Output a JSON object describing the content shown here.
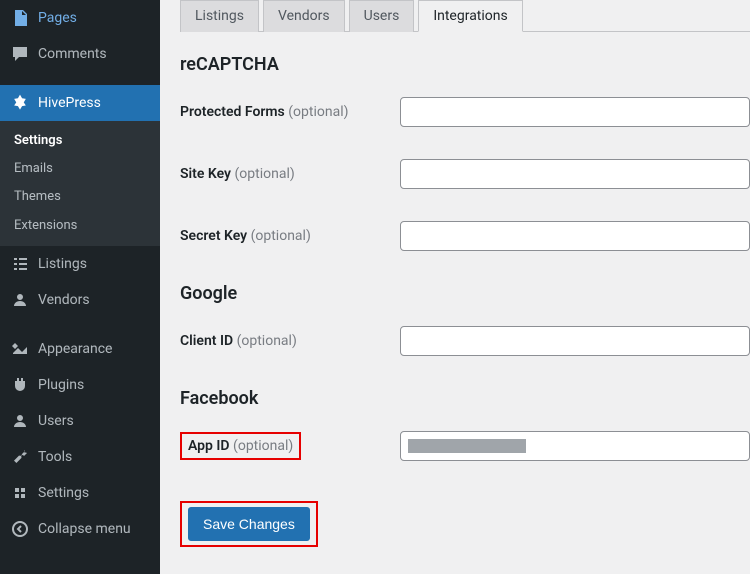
{
  "sidebar": {
    "pages": "Pages",
    "comments": "Comments",
    "hivepress": "HivePress",
    "submenu": {
      "settings": "Settings",
      "emails": "Emails",
      "themes": "Themes",
      "extensions": "Extensions"
    },
    "listings": "Listings",
    "vendors": "Vendors",
    "appearance": "Appearance",
    "plugins": "Plugins",
    "users": "Users",
    "tools": "Tools",
    "settings_main": "Settings",
    "collapse": "Collapse menu"
  },
  "tabs": {
    "listings": "Listings",
    "vendors": "Vendors",
    "users": "Users",
    "integrations": "Integrations"
  },
  "sections": {
    "recaptcha": "reCAPTCHA",
    "google": "Google",
    "facebook": "Facebook"
  },
  "fields": {
    "protected_forms": {
      "label": "Protected Forms",
      "optional": "(optional)",
      "value": ""
    },
    "site_key": {
      "label": "Site Key",
      "optional": "(optional)",
      "value": ""
    },
    "secret_key": {
      "label": "Secret Key",
      "optional": "(optional)",
      "value": ""
    },
    "client_id": {
      "label": "Client ID",
      "optional": "(optional)",
      "value": ""
    },
    "app_id": {
      "label": "App ID",
      "optional": "(optional)",
      "value": ""
    }
  },
  "buttons": {
    "save": "Save Changes"
  }
}
